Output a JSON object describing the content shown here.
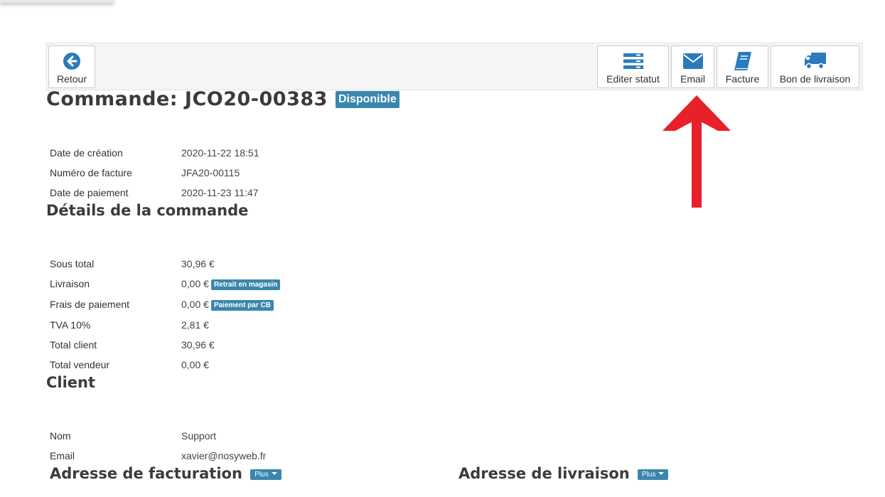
{
  "toolbar": {
    "back_label": "Retour",
    "edit_status_label": "Editer statut",
    "email_label": "Email",
    "invoice_label": "Facture",
    "delivery_note_label": "Bon de livraison"
  },
  "order": {
    "title": "Commande: JCO20-00383",
    "status_badge": "Disponible",
    "info": [
      {
        "label": "Date de création",
        "value": "2020-11-22 18:51"
      },
      {
        "label": "Numéro de facture",
        "value": "JFA20-00115"
      },
      {
        "label": "Date de paiement",
        "value": "2020-11-23 11:47"
      }
    ]
  },
  "details": {
    "title": "Détails de la commande",
    "rows": [
      {
        "label": "Sous total",
        "value": "30,96 €",
        "badge": ""
      },
      {
        "label": "Livraison",
        "value": "0,00 €",
        "badge": "Retrait en magasin"
      },
      {
        "label": "Frais de paiement",
        "value": "0,00 €",
        "badge": "Paiement par CB"
      },
      {
        "label": "TVA 10%",
        "value": "2,81 €",
        "badge": ""
      },
      {
        "label": "Total client",
        "value": "30,96 €",
        "badge": ""
      },
      {
        "label": "Total vendeur",
        "value": "0,00 €",
        "badge": ""
      }
    ]
  },
  "client": {
    "title": "Client",
    "rows": [
      {
        "label": "Nom",
        "value": "Support"
      },
      {
        "label": "Email",
        "value": "xavier@nosyweb.fr"
      }
    ]
  },
  "addresses": {
    "billing_title": "Adresse de facturation",
    "shipping_title": "Adresse de livraison",
    "more_label": "Plus"
  },
  "colors": {
    "accent": "#3a87ad",
    "icon": "#2a7bbd",
    "arrow": "#e8202a"
  },
  "icons": [
    "arrow-circle-left-icon",
    "list-icon",
    "envelope-icon",
    "book-icon",
    "truck-icon",
    "red-arrow-up-icon"
  ]
}
